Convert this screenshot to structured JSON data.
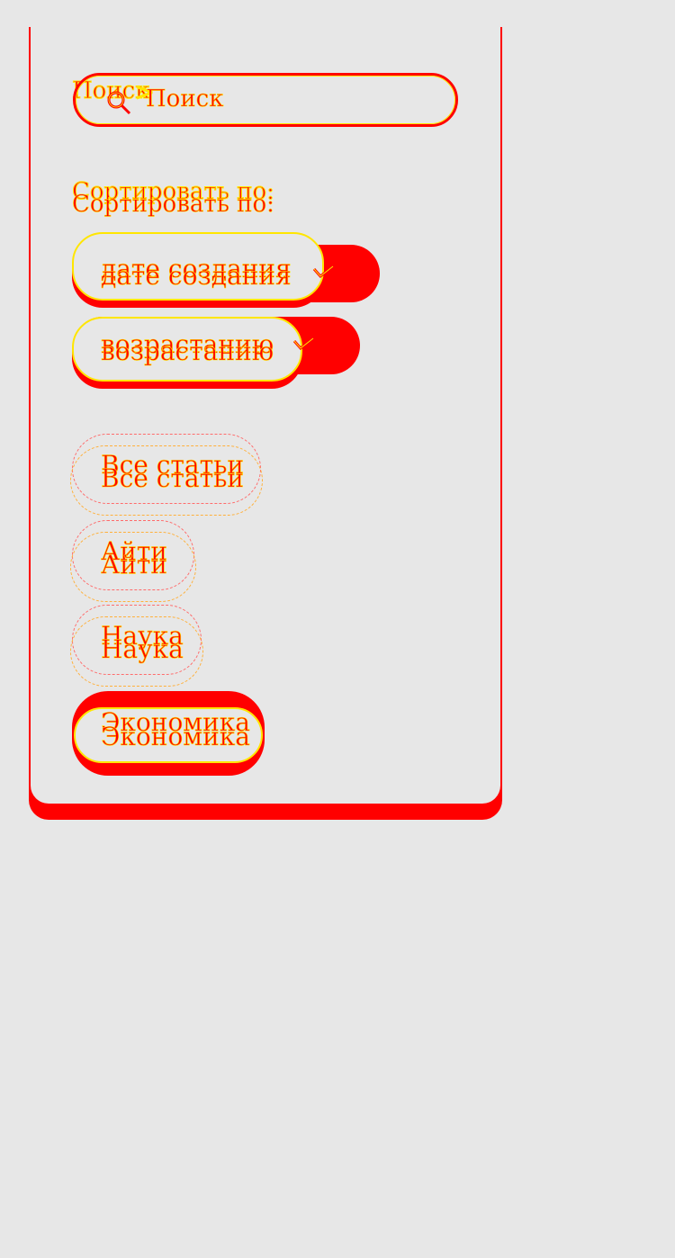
{
  "search": {
    "label": "Поиск",
    "placeholder": "Поиск"
  },
  "sort": {
    "label": "Сортировать по:",
    "field_value": "дате создания",
    "order_value": "возрастанию"
  },
  "categories": [
    {
      "label": "Все статьи",
      "active": false
    },
    {
      "label": "Айти",
      "active": false
    },
    {
      "label": "Наука",
      "active": false
    },
    {
      "label": "Экономика",
      "active": true
    }
  ],
  "colors": {
    "accent": "#ff0000",
    "outline": "#ffe600",
    "background": "#e7e7e7"
  }
}
